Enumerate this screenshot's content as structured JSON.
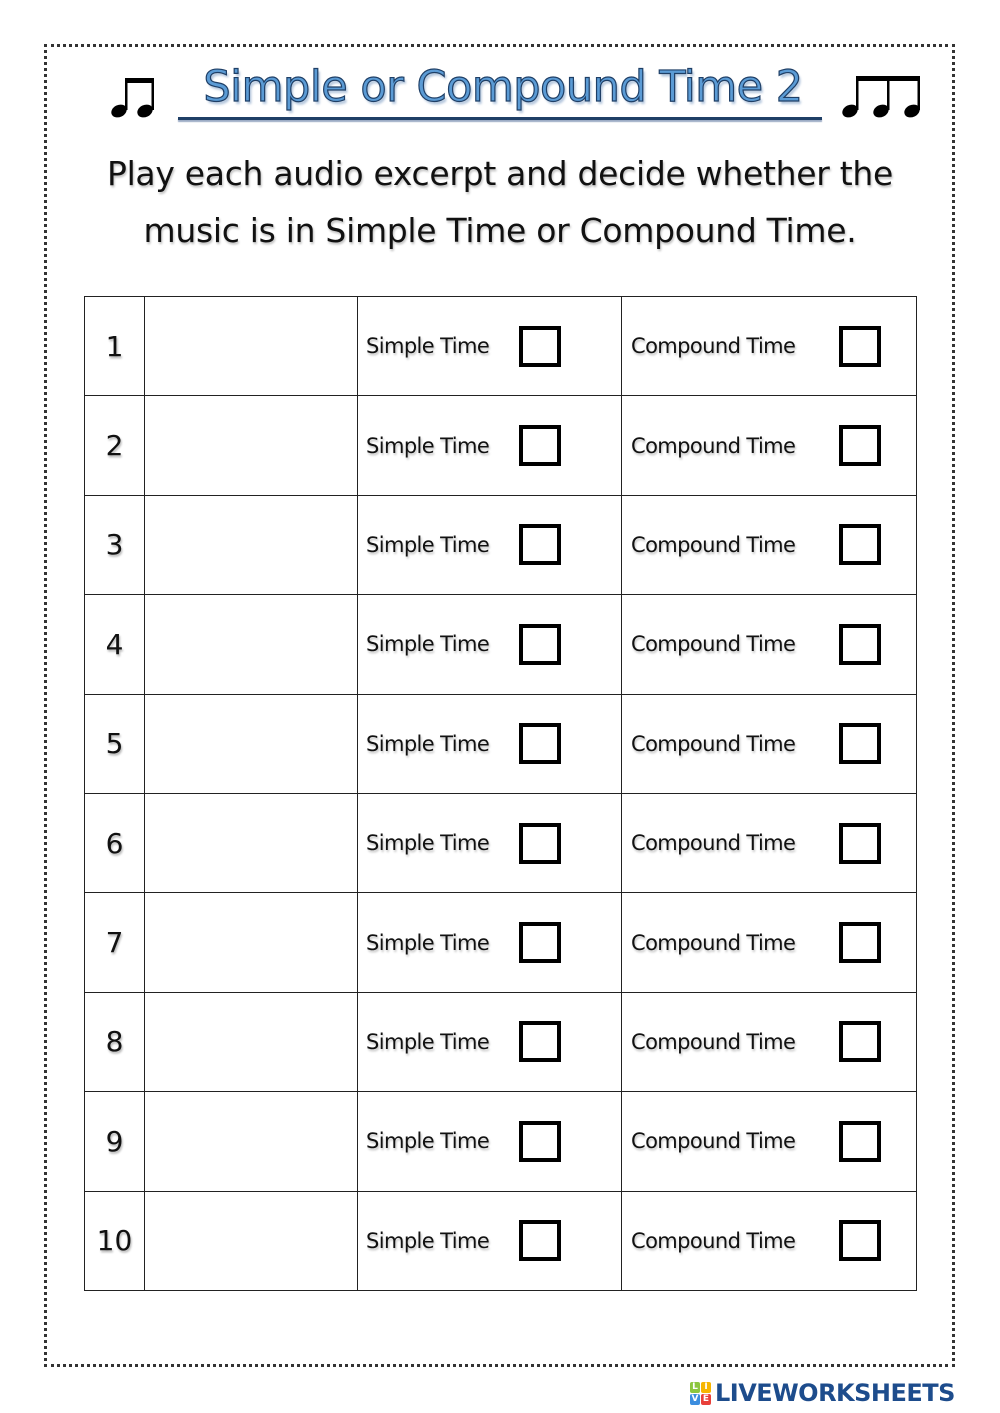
{
  "worksheet": {
    "title": "Simple or Compound Time 2",
    "title_color": "#5b9bd5",
    "left_icon": "beamed-eighth-notes-icon",
    "right_icon": "beamed-three-eighth-notes-icon",
    "instructions": "Play each audio excerpt and decide whether the music is in Simple Time or Compound Time."
  },
  "table": {
    "rows": [
      {
        "number": "1",
        "simple_label": "Simple Time",
        "compound_label": "Compound Time",
        "simple_checked": false,
        "compound_checked": false
      },
      {
        "number": "2",
        "simple_label": "Simple Time",
        "compound_label": "Compound Time",
        "simple_checked": false,
        "compound_checked": false
      },
      {
        "number": "3",
        "simple_label": "Simple Time",
        "compound_label": "Compound Time",
        "simple_checked": false,
        "compound_checked": false
      },
      {
        "number": "4",
        "simple_label": "Simple Time",
        "compound_label": "Compound Time",
        "simple_checked": false,
        "compound_checked": false
      },
      {
        "number": "5",
        "simple_label": "Simple Time",
        "compound_label": "Compound Time",
        "simple_checked": false,
        "compound_checked": false
      },
      {
        "number": "6",
        "simple_label": "Simple Time",
        "compound_label": "Compound Time",
        "simple_checked": false,
        "compound_checked": false
      },
      {
        "number": "7",
        "simple_label": "Simple Time",
        "compound_label": "Compound Time",
        "simple_checked": false,
        "compound_checked": false
      },
      {
        "number": "8",
        "simple_label": "Simple Time",
        "compound_label": "Compound Time",
        "simple_checked": false,
        "compound_checked": false
      },
      {
        "number": "9",
        "simple_label": "Simple Time",
        "compound_label": "Compound Time",
        "simple_checked": false,
        "compound_checked": false
      },
      {
        "number": "10",
        "simple_label": "Simple Time",
        "compound_label": "Compound Time",
        "simple_checked": false,
        "compound_checked": false
      }
    ]
  },
  "footer": {
    "logo_letters": [
      "L",
      "I",
      "V",
      "E"
    ],
    "logo_colors": [
      "#8dc63f",
      "#f7b500",
      "#3c8dde",
      "#e8403a"
    ],
    "brand": "LIVEWORKSHEETS",
    "brand_color": "#1d4c8c"
  }
}
